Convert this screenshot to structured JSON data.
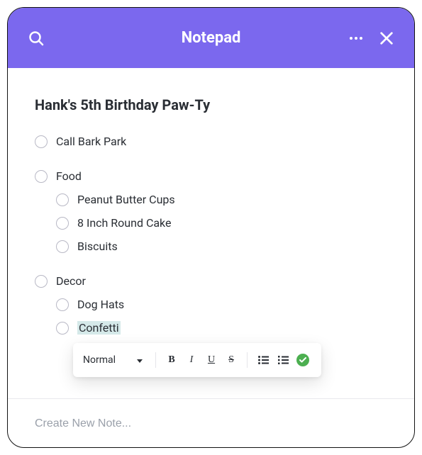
{
  "header": {
    "title": "Notepad"
  },
  "note": {
    "title": "Hank's 5th Birthday Paw-Ty",
    "items": {
      "i0": "Call Bark Park",
      "i1": "Food",
      "i1_0": "Peanut Butter Cups",
      "i1_1": "8 Inch Round Cake",
      "i1_2": "Biscuits",
      "i2": "Decor",
      "i2_0": "Dog Hats",
      "i2_1": "Confetti"
    }
  },
  "toolbar": {
    "style_label": "Normal",
    "bold": "B",
    "italic": "I",
    "underline": "U",
    "strike": "S"
  },
  "footer": {
    "placeholder": "Create New Note..."
  }
}
